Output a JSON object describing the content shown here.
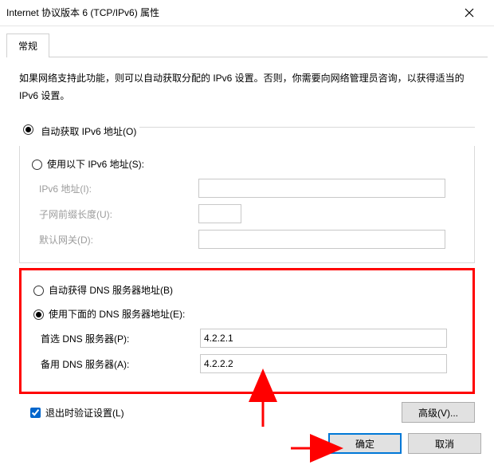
{
  "title": "Internet 协议版本 6 (TCP/IPv6) 属性",
  "tab": "常规",
  "description": "如果网络支持此功能，则可以自动获取分配的 IPv6 设置。否则，你需要向网络管理员咨询，以获得适当的 IPv6 设置。",
  "addr": {
    "auto_label": "自动获取 IPv6 地址(O)",
    "manual_label": "使用以下 IPv6 地址(S):",
    "selected": "auto",
    "ip_label": "IPv6 地址(I):",
    "prefix_label": "子网前缀长度(U):",
    "gw_label": "默认网关(D):",
    "ip_value": "",
    "prefix_value": "",
    "gw_value": ""
  },
  "dns": {
    "auto_label": "自动获得 DNS 服务器地址(B)",
    "manual_label": "使用下面的 DNS 服务器地址(E):",
    "selected": "manual",
    "primary_label": "首选 DNS 服务器(P):",
    "alt_label": "备用 DNS 服务器(A):",
    "primary_value": "4.2.2.1",
    "alt_value": "4.2.2.2"
  },
  "validate": {
    "label": "退出时验证设置(L)",
    "checked": true
  },
  "buttons": {
    "advanced": "高级(V)...",
    "ok": "确定",
    "cancel": "取消"
  }
}
